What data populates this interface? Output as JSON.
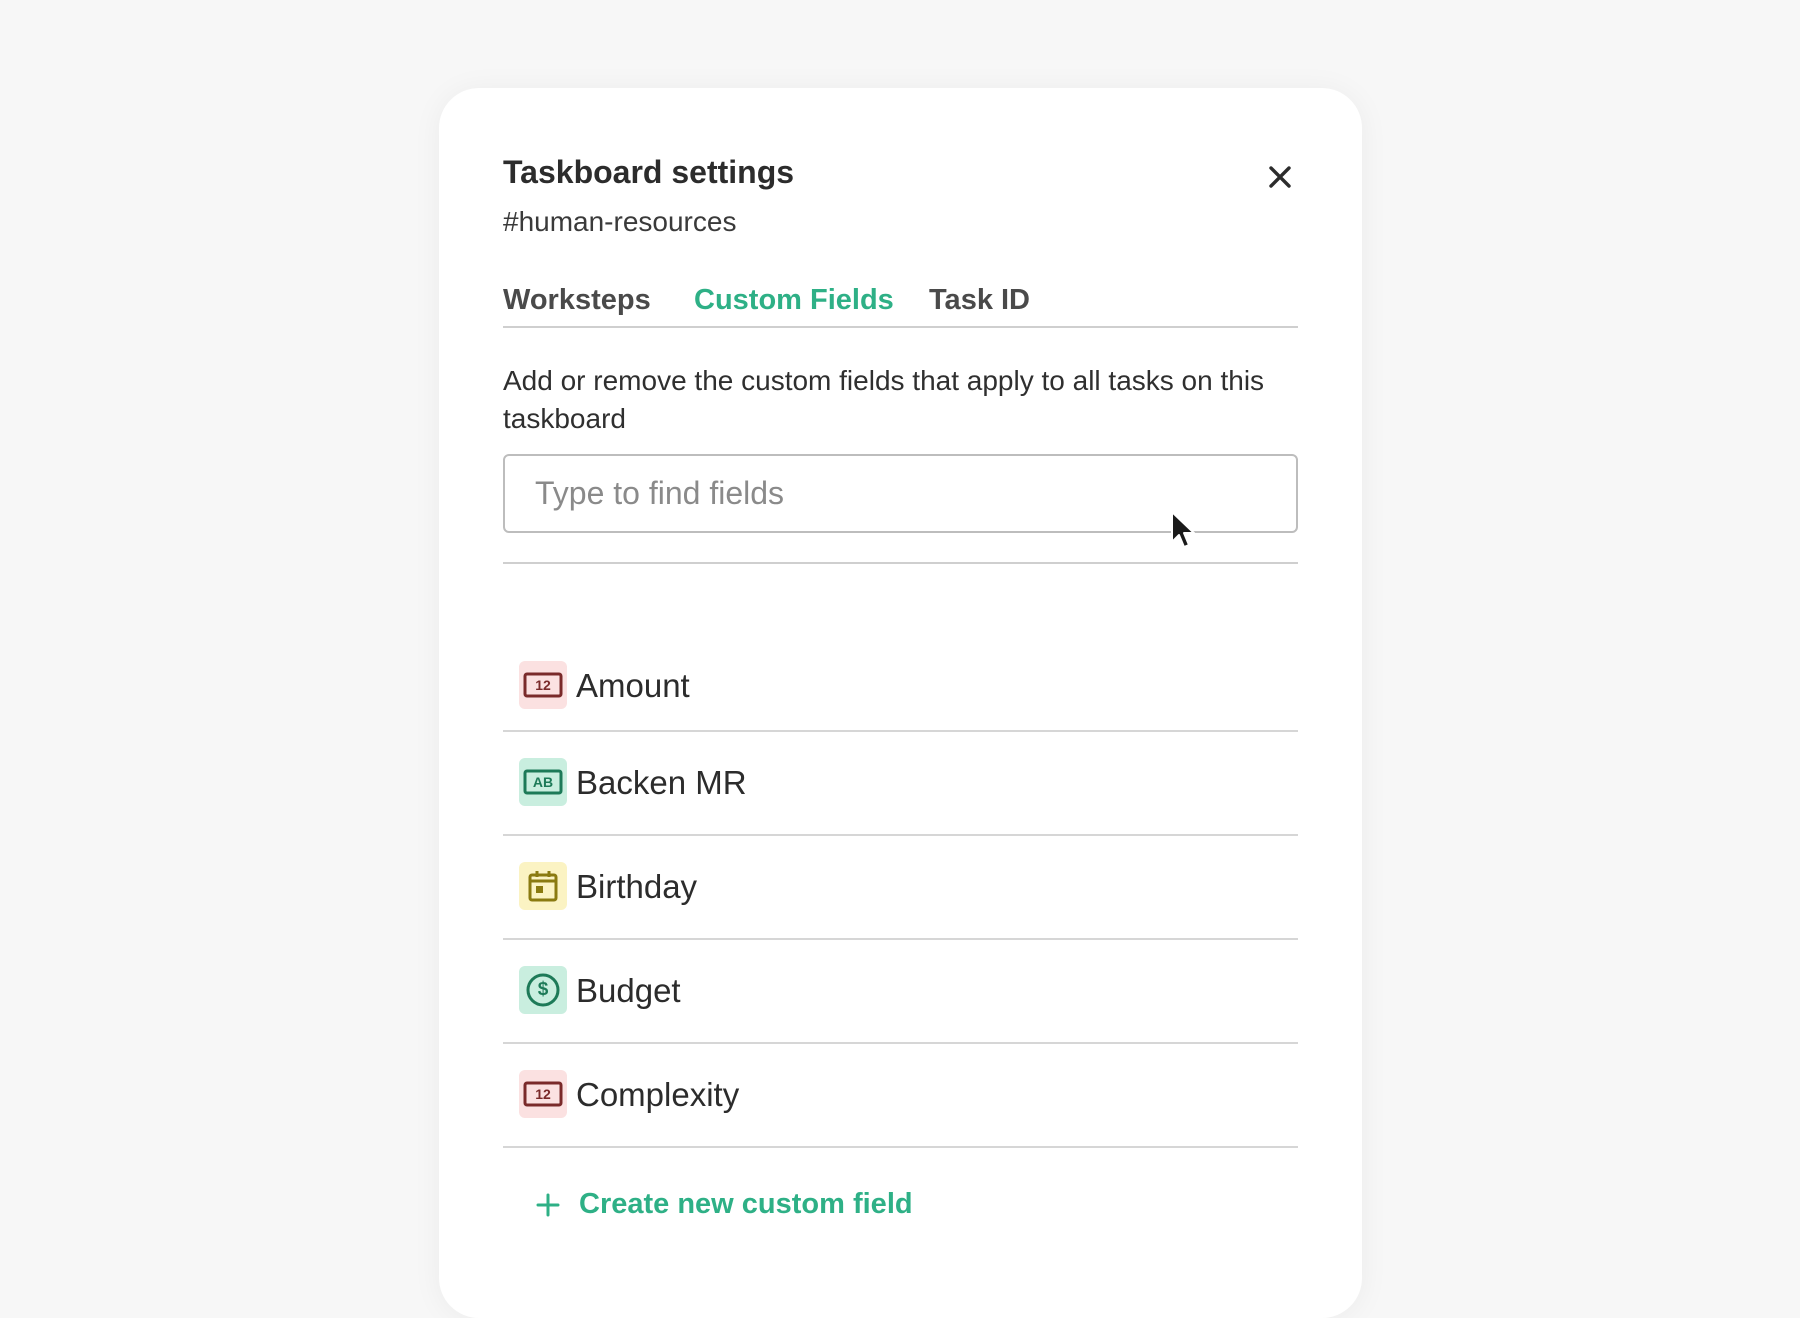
{
  "dialog": {
    "title": "Taskboard settings",
    "subtitle": "#human-resources",
    "close_icon": "close-icon"
  },
  "tabs": [
    {
      "label": "Worksteps",
      "active": false
    },
    {
      "label": "Custom Fields",
      "active": true
    },
    {
      "label": "Task ID",
      "active": false
    }
  ],
  "description": "Add or remove the custom fields that apply to all tasks on this taskboard",
  "search": {
    "placeholder": "Type to find fields",
    "value": ""
  },
  "fields": [
    {
      "label": "Amount",
      "icon": "number-icon",
      "icon_text": "12",
      "bg": "#fbe1e1",
      "color": "#7a2a2a"
    },
    {
      "label": "Backen MR",
      "icon": "text-icon",
      "icon_text": "AB",
      "bg": "#c9eedf",
      "color": "#1d7a58"
    },
    {
      "label": "Birthday",
      "icon": "calendar-icon",
      "bg": "#fbf3c3",
      "color": "#8a7a10"
    },
    {
      "label": "Budget",
      "icon": "currency-icon",
      "icon_text": "$",
      "bg": "#c9eedf",
      "color": "#1d7a58"
    },
    {
      "label": "Complexity",
      "icon": "number-icon",
      "icon_text": "12",
      "bg": "#fbe1e1",
      "color": "#7a2a2a"
    }
  ],
  "create_button": {
    "label": "Create new custom field",
    "icon": "plus-icon"
  },
  "colors": {
    "accent": "#2eb086",
    "text": "#2c2c2c",
    "divider": "#d6d6d6"
  }
}
